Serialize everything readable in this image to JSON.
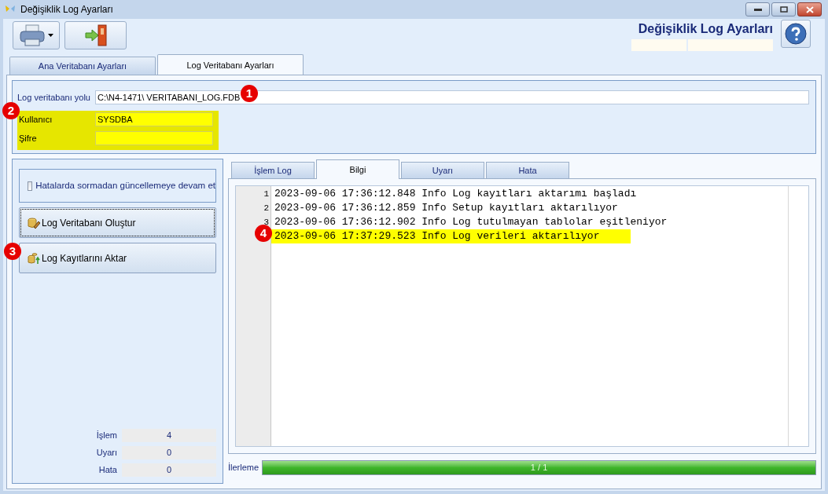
{
  "window": {
    "title": "Değişiklik Log Ayarları"
  },
  "header": {
    "title": "Değişiklik Log Ayarları"
  },
  "main_tabs": [
    {
      "label": "Ana Veritabanı Ayarları",
      "selected": false
    },
    {
      "label": "Log Veritabanı Ayarları",
      "selected": true
    }
  ],
  "connection": {
    "path_label": "Log veritabanı yolu",
    "path_value": "C:\\N4-1471\\ VERITABANI_LOG.FDB",
    "user_label": "Kullanıcı",
    "user_value": "SYSDBA",
    "password_label": "Şifre"
  },
  "options": [
    {
      "label": "Hatalarda sormadan güncellemeye devam et",
      "checked": false
    }
  ],
  "actions": [
    {
      "label": "Log Veritabanı Oluştur",
      "kind": "create",
      "focused": true
    },
    {
      "label": "Log Kayıtlarını Aktar",
      "kind": "transfer",
      "focused": false
    }
  ],
  "counters": [
    {
      "label": "İşlem",
      "value": "4"
    },
    {
      "label": "Uyarı",
      "value": "0"
    },
    {
      "label": "Hata",
      "value": "0"
    }
  ],
  "log_tabs": [
    {
      "label": "İşlem Log",
      "selected": false
    },
    {
      "label": "Bilgi",
      "selected": true
    },
    {
      "label": "Uyarı",
      "selected": false
    },
    {
      "label": "Hata",
      "selected": false
    }
  ],
  "log_lines": [
    {
      "number": "1",
      "text": "2023-09-06 17:36:12.848 Info Log kayıtları aktarımı başladı",
      "highlighted": false
    },
    {
      "number": "2",
      "text": "2023-09-06 17:36:12.859 Info Setup kayıtları aktarılıyor",
      "highlighted": false
    },
    {
      "number": "3",
      "text": "2023-09-06 17:36:12.902 Info Log tutulmayan tablolar eşitleniyor",
      "highlighted": false
    },
    {
      "text": "2023-09-06 17:37:29.523 Info Log verileri aktarılıyor",
      "highlighted": true
    }
  ],
  "progress": {
    "label": "İlerleme",
    "level": 1,
    "reading": "1 / 1"
  },
  "callouts": [
    "1",
    "2",
    "3",
    "4"
  ]
}
